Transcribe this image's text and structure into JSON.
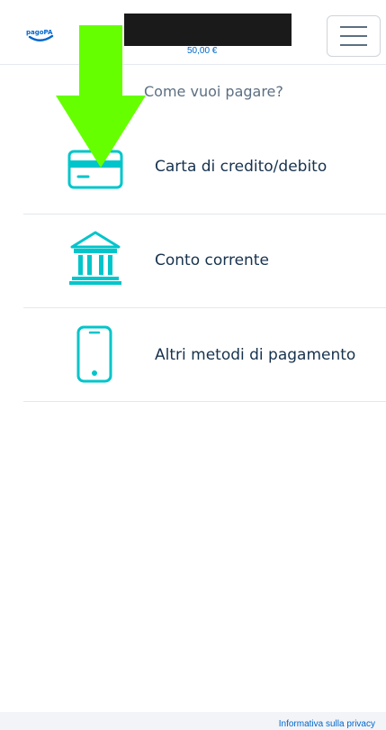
{
  "header": {
    "logo_icon": "pagopa-logo-icon",
    "amount": "50,00 €",
    "menu_icon": "hamburger-menu-icon"
  },
  "main": {
    "prompt": "Come vuoi pagare?",
    "options": [
      {
        "label": "Carta di credito/debito",
        "icon": "credit-card-icon"
      },
      {
        "label": "Conto corrente",
        "icon": "bank-icon"
      },
      {
        "label": "Altri metodi di pagamento",
        "icon": "smartphone-icon"
      }
    ]
  },
  "footer": {
    "privacy_link": "Informativa sulla privacy"
  },
  "colors": {
    "accent": "#00c5ca",
    "arrow": "#66ff00",
    "link": "#0066cc"
  }
}
